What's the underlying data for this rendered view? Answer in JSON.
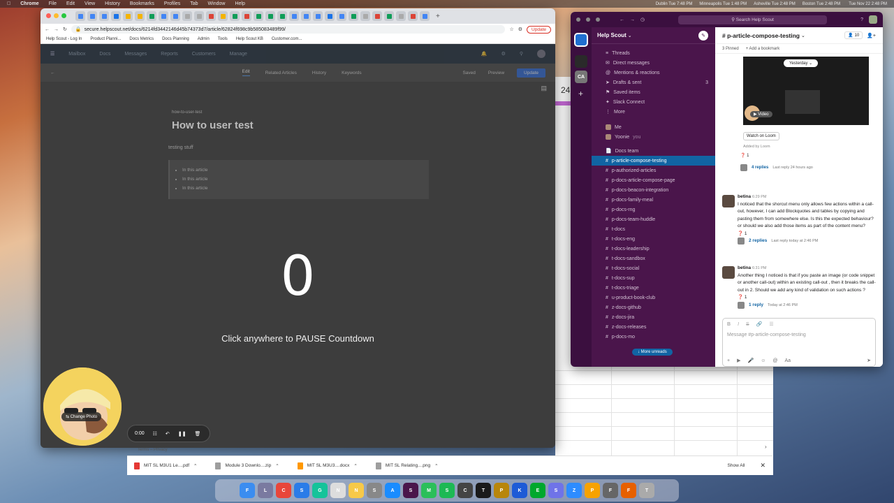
{
  "menubar": {
    "app": "Chrome",
    "items": [
      "File",
      "Edit",
      "View",
      "History",
      "Bookmarks",
      "Profiles",
      "Tab",
      "Window",
      "Help"
    ],
    "clocks": [
      "Dublin Tue 7:48 PM",
      "Minneapolis Tue 1:48 PM",
      "Asheville Tue 2:48 PM",
      "Boston Tue 2:48 PM"
    ],
    "datetime": "Tue Nov 22  2:48 PM"
  },
  "browser": {
    "url": "secure.helpscout.net/docs/6214fd3442146d45b74373d7/article/62824f698c9b585083489f99/",
    "update_label": "Update",
    "bookmarks": [
      "Help Scout - Log In",
      "Product Planni...",
      "Docs Metrics",
      "Docs Planning",
      "Admin",
      "Tools",
      "Help Scout KB",
      "Customer.com..."
    ],
    "nav": [
      "Mailbox",
      "Docs",
      "Messages",
      "Reports",
      "Customers",
      "Manage"
    ],
    "editor_tabs": [
      "Edit",
      "Related Articles",
      "History",
      "Keywords"
    ],
    "saved_label": "Saved",
    "preview_label": "Preview",
    "save_label": "Update"
  },
  "article": {
    "slug": "how-to-user-test",
    "title": "How to user test",
    "body": "testing stuff",
    "bullets": [
      "In this article",
      "In this article",
      "In this article"
    ]
  },
  "countdown": {
    "number": "0",
    "message": "Click anywhere to PAUSE Countdown"
  },
  "loom": {
    "change_photo": "Change Photo",
    "timer": "0:00"
  },
  "sheet": {
    "terms": "Terms – Privacy",
    "date": "24"
  },
  "downloads": {
    "items": [
      "MIT SL M3U1 Le....pdf",
      "Module 3 Downlo....zip",
      "MIT SL M3U3....docx",
      "MIT SL Relating....png"
    ],
    "colors": [
      "#e53935",
      "#9e9e9e",
      "#ff9800",
      "#9e9e9e"
    ],
    "show_all": "Show All"
  },
  "slack": {
    "search": "Search Help Scout",
    "workspace": "Help Scout",
    "rail_label": "CA",
    "nav": [
      {
        "icon": "≡",
        "label": "Threads"
      },
      {
        "icon": "✉",
        "label": "Direct messages"
      },
      {
        "icon": "@",
        "label": "Mentions & reactions"
      },
      {
        "icon": "➤",
        "label": "Drafts & sent"
      },
      {
        "icon": "⚑",
        "label": "Saved items"
      },
      {
        "icon": "✦",
        "label": "Slack Connect"
      },
      {
        "icon": "⋮",
        "label": "More"
      }
    ],
    "drafts_count": "3",
    "dms": [
      {
        "label": "Me",
        "suffix": ""
      },
      {
        "label": "Yoonie",
        "suffix": "you"
      }
    ],
    "docs_team": "Docs team",
    "channels": [
      "p-article-compose-testing",
      "p-authorized-articles",
      "p-docs-article-compose-page",
      "p-docs-beacon-integration",
      "p-docs-family-meal",
      "p-docs-rng",
      "p-docs-team-huddle",
      "t-docs",
      "t-docs-eng",
      "t-docs-leadership",
      "t-docs-sandbox",
      "t-docs-social",
      "t-docs-sup",
      "t-docs-triage",
      "u-product-book-club",
      "z-docs-github",
      "z-docs-jira",
      "z-docs-releases",
      "p-docs-mo"
    ],
    "more_unreads": "More unreads",
    "footer_channel": "p-article-compose-testing",
    "channel": {
      "name": "# p-article-compose-testing",
      "members": "10",
      "pinned": "3 Pinned",
      "add_bookmark": "+ Add a bookmark"
    },
    "loom_card": {
      "yesterday": "Yesterday",
      "video": "Video",
      "watch": "Watch on Loom",
      "added_by": "Added by Loom",
      "replies": "4 replies",
      "last_reply": "Last reply 24 hours ago"
    },
    "messages": [
      {
        "author": "betina",
        "time": "6:29 PM",
        "text": "I noticed that the shorcut menu only allows few actions within a call-out, however, I can add Blockquotes and tables by copying and pasting them from somewhere else. Is this the expected behaviour? or should we also add those items as part of the content menu?",
        "replies": "2 replies",
        "last": "Last reply today at 2:46 PM"
      },
      {
        "author": "betina",
        "time": "6:31 PM",
        "text": "Another thing I noticed is that if you paste an image (or code snippet or another call-out) within an existing call-out , then it breaks the call-out in 2. Should we add any kind of validation on such actions ?",
        "replies": "1 reply",
        "last": "Today at 2:46 PM"
      }
    ],
    "reaction": "❓ 1",
    "composer": "Message #p-article-compose-testing"
  },
  "dock": [
    {
      "l": "F",
      "c": "#3b8df0"
    },
    {
      "l": "L",
      "c": "#7a7aa0"
    },
    {
      "l": "C",
      "c": "#e8463a"
    },
    {
      "l": "S",
      "c": "#2a7ce8"
    },
    {
      "l": "G",
      "c": "#15c39a"
    },
    {
      "l": "N",
      "c": "#ddd"
    },
    {
      "l": "N",
      "c": "#f7c948"
    },
    {
      "l": "S",
      "c": "#888"
    },
    {
      "l": "A",
      "c": "#1a8cff"
    },
    {
      "l": "S",
      "c": "#4a154b"
    },
    {
      "l": "M",
      "c": "#2bbf5a"
    },
    {
      "l": "S",
      "c": "#1db954"
    },
    {
      "l": "C",
      "c": "#444"
    },
    {
      "l": "T",
      "c": "#1a1a1a"
    },
    {
      "l": "P",
      "c": "#b8860b"
    },
    {
      "l": "K",
      "c": "#1d5bd6"
    },
    {
      "l": "E",
      "c": "#00a82d"
    },
    {
      "l": "S",
      "c": "#6f73e8"
    },
    {
      "l": "Z",
      "c": "#2d8cff"
    },
    {
      "l": "P",
      "c": "#f7a200"
    },
    {
      "l": "F",
      "c": "#666"
    },
    {
      "l": "F",
      "c": "#e66000"
    },
    {
      "l": "T",
      "c": "#aaa"
    }
  ]
}
